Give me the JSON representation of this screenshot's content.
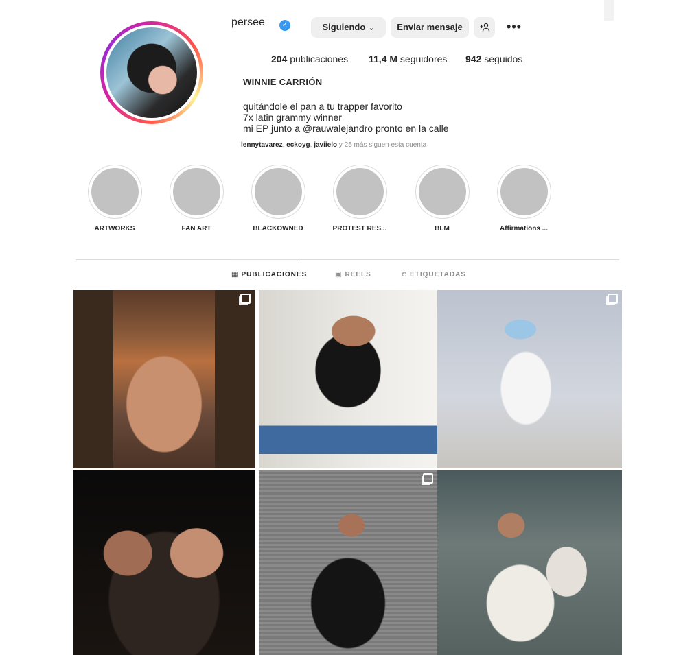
{
  "profile": {
    "username": "persee",
    "verified_icon": "verified-badge-icon",
    "follow_button": "Siguiendo",
    "message_button": "Enviar mensaje",
    "add_user_icon": "+👤",
    "more_icon": "•••",
    "stats": {
      "posts_count": "204",
      "posts_label": "publicaciones",
      "followers_count": "11,4 M",
      "followers_label": "seguidores",
      "following_count": "942",
      "following_label": "seguidos"
    },
    "full_name": "WINNIE CARRIÓN",
    "bio_lines": [
      "quitándole el pan a tu trapper favorito",
      "7x latin grammy winner",
      "mi EP junto a @rauwalejandro pronto en la calle"
    ],
    "followed_by": {
      "user1": "lennytavarez",
      "sep1": ", ",
      "user2": "eckoyg",
      "sep2": ", ",
      "user3": "javiielo",
      "rest": " y 25 más siguen esta cuenta"
    }
  },
  "highlights": [
    {
      "label": "ARTWORKS"
    },
    {
      "label": "FAN ART"
    },
    {
      "label": "BLACKOWNED"
    },
    {
      "label": "PROTEST RES..."
    },
    {
      "label": "BLM"
    },
    {
      "label": "Affirmations ..."
    }
  ],
  "tabs": [
    {
      "label": "PUBLICACIONES",
      "icon": "grid-icon"
    },
    {
      "label": "REELS",
      "icon": "reels-icon"
    },
    {
      "label": "ETIQUETADAS",
      "icon": "tagged-icon"
    }
  ],
  "colors": {
    "accent_blue": "#3897f0",
    "button_bg": "#efefef",
    "muted_text": "#8e8e8e",
    "highlight_placeholder": "#c2c2c2"
  }
}
